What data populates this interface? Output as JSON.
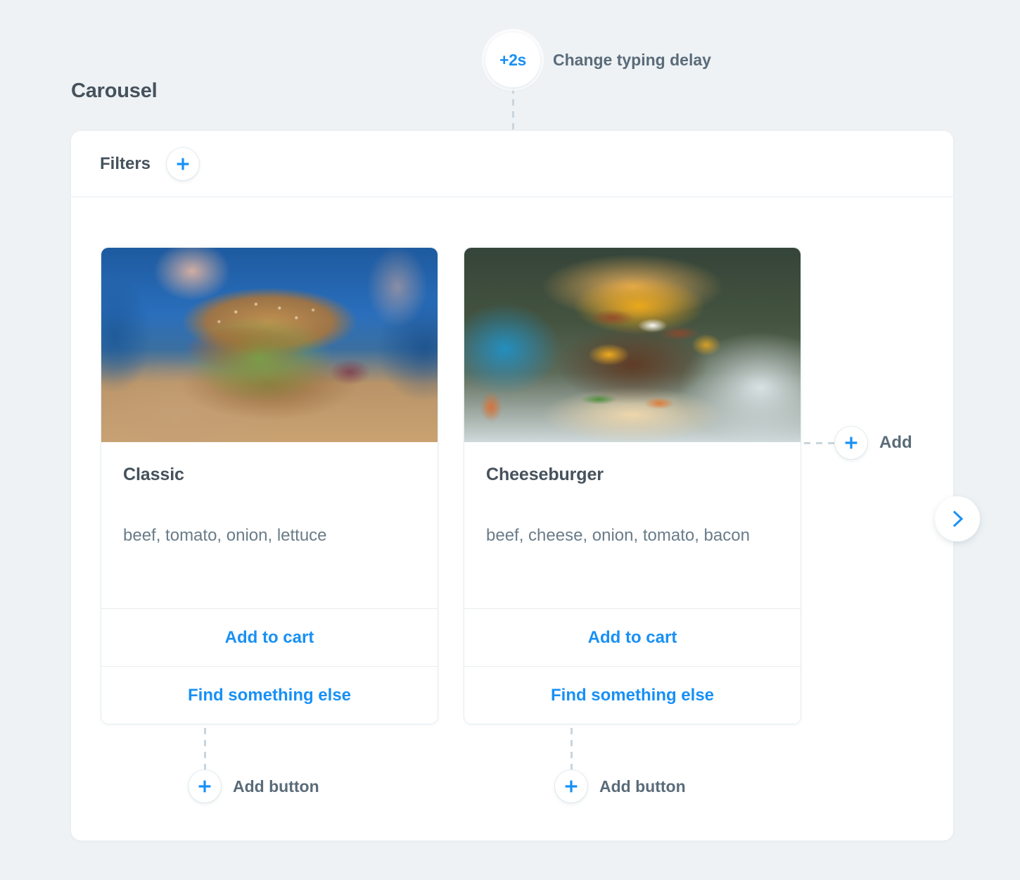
{
  "theme": {
    "background": "#eef2f5",
    "panel_bg": "#ffffff",
    "accent_blue": "#1890f5",
    "text_dark": "#46525c",
    "text_muted": "#6a7c89",
    "dash_color": "#c9d5dd",
    "border": "#e4ecf0"
  },
  "section": {
    "title": "Carousel"
  },
  "timing_annotation": {
    "badge": "+2s",
    "label": "Change typing delay"
  },
  "panel": {
    "header": {
      "filters_label": "Filters",
      "add_filter_icon": "plus-icon"
    }
  },
  "cards": [
    {
      "title": "Classic",
      "description": "beef, tomato, onion, lettuce",
      "image_alt": "classic-burger-photo",
      "actions": [
        {
          "label": "Add to cart"
        },
        {
          "label": "Find something else"
        }
      ],
      "annotation": {
        "icon": "plus-icon",
        "label": "Add button"
      }
    },
    {
      "title": "Cheeseburger",
      "description": "beef, cheese, onion, tomato, bacon",
      "image_alt": "cheeseburger-photo",
      "actions": [
        {
          "label": "Add to cart"
        },
        {
          "label": "Find something else"
        }
      ],
      "annotation": {
        "icon": "plus-icon",
        "label": "Add button"
      }
    }
  ],
  "card_add_annotation": {
    "icon": "plus-icon",
    "label": "Add"
  },
  "carousel_nav": {
    "next_icon": "chevron-right-icon"
  }
}
